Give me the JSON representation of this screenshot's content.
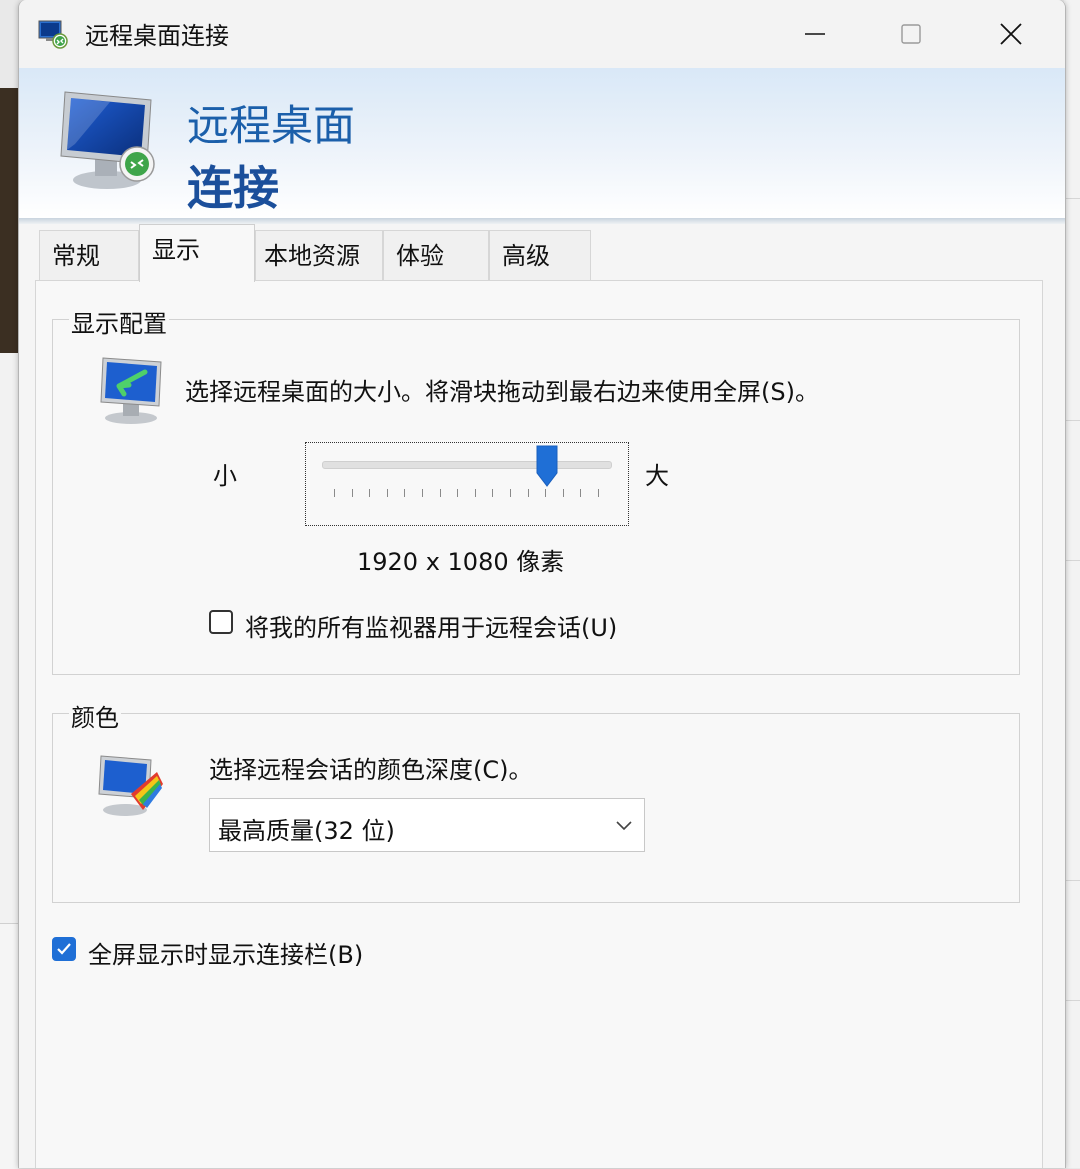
{
  "window": {
    "title": "远程桌面连接",
    "icons": [
      "remote-desktop-app-icon",
      "minimize-icon",
      "maximize-icon",
      "close-icon"
    ]
  },
  "banner": {
    "title_line1": "远程桌面",
    "title_line2": "连接"
  },
  "tabs": [
    {
      "label": "常规",
      "active": false
    },
    {
      "label": "显示",
      "active": true
    },
    {
      "label": "本地资源",
      "active": false
    },
    {
      "label": "体验",
      "active": false
    },
    {
      "label": "高级",
      "active": false
    }
  ],
  "display_config": {
    "legend": "显示配置",
    "description": "选择远程桌面的大小。将滑块拖动到最右边来使用全屏(S)。",
    "slider": {
      "min_label": "小",
      "max_label": "大",
      "level": 0.78,
      "tick_count": 16
    },
    "resolution_text": "1920 x 1080 像素",
    "all_monitors_checkbox": {
      "label": "将我的所有监视器用于远程会话(U)",
      "checked": false
    }
  },
  "colors": {
    "legend": "颜色",
    "description": "选择远程会话的颜色深度(C)。",
    "depth_select": {
      "value": "最高质量(32 位)"
    }
  },
  "connection_bar_checkbox": {
    "label": "全屏显示时显示连接栏(B)",
    "checked": true
  },
  "theme": {
    "accent": "#1f6fd6",
    "banner_blue": "#1b5faa"
  }
}
